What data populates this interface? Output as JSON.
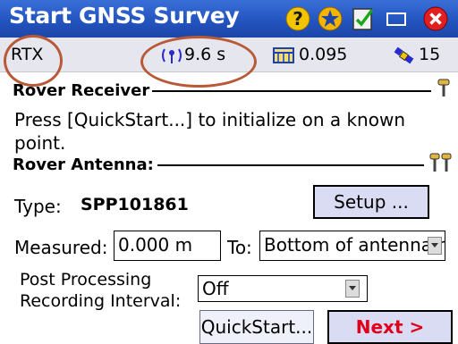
{
  "window": {
    "title": "Start GNSS Survey",
    "icons": [
      "help-icon",
      "favorite-star-icon",
      "checklist-icon",
      "minimize-icon",
      "close-icon"
    ]
  },
  "status": {
    "mode": "RTX",
    "latency": "9.6 s",
    "precision": "0.095",
    "satellites": "15"
  },
  "rover_receiver": {
    "header": "Rover Receiver",
    "message": "Press [QuickStart...] to initialize on a known point."
  },
  "rover_antenna": {
    "header": "Rover Antenna:",
    "type_label": "Type:",
    "type_value": "SPP101861",
    "setup_label": "Setup ...",
    "measured_label": "Measured:",
    "measured_value": "0.000 m",
    "to_label": "To:",
    "to_value": "Bottom of antenna r",
    "post_processing_label_1": "Post Processing",
    "post_processing_label_2": "Recording Interval:",
    "interval_value": "Off"
  },
  "actions": {
    "quickstart_label": "QuickStart...",
    "next_label": "Next >"
  },
  "colors": {
    "titlebar": "#2354bf",
    "annotation_ellipse": "#b85a38",
    "next_text": "#e0001b",
    "button_fill": "#d9dcf2"
  }
}
